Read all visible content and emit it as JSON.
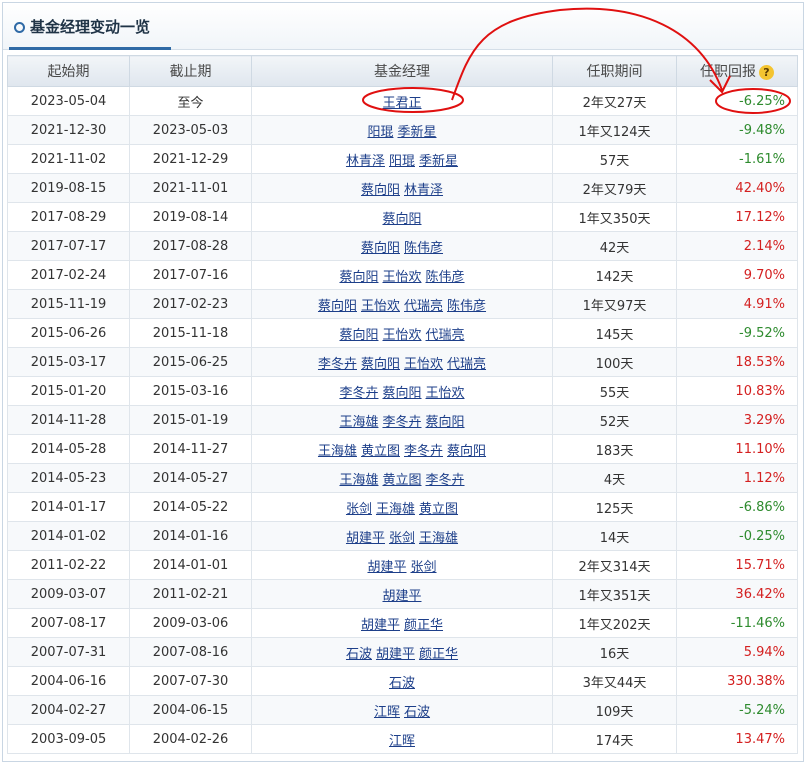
{
  "panel": {
    "title": "基金经理变动一览"
  },
  "table": {
    "headers": {
      "start": "起始期",
      "end": "截止期",
      "managers": "基金经理",
      "period": "任职期间",
      "return": "任职回报",
      "help_icon": "?"
    },
    "rows": [
      {
        "start": "2023-05-04",
        "end": "至今",
        "managers": [
          "王君正"
        ],
        "period": "2年又27天",
        "return": "-6.25%",
        "sign": "neg"
      },
      {
        "start": "2021-12-30",
        "end": "2023-05-03",
        "managers": [
          "阳琨",
          "季新星"
        ],
        "period": "1年又124天",
        "return": "-9.48%",
        "sign": "neg"
      },
      {
        "start": "2021-11-02",
        "end": "2021-12-29",
        "managers": [
          "林青泽",
          "阳琨",
          "季新星"
        ],
        "period": "57天",
        "return": "-1.61%",
        "sign": "neg"
      },
      {
        "start": "2019-08-15",
        "end": "2021-11-01",
        "managers": [
          "蔡向阳",
          "林青泽"
        ],
        "period": "2年又79天",
        "return": "42.40%",
        "sign": "pos"
      },
      {
        "start": "2017-08-29",
        "end": "2019-08-14",
        "managers": [
          "蔡向阳"
        ],
        "period": "1年又350天",
        "return": "17.12%",
        "sign": "pos"
      },
      {
        "start": "2017-07-17",
        "end": "2017-08-28",
        "managers": [
          "蔡向阳",
          "陈伟彦"
        ],
        "period": "42天",
        "return": "2.14%",
        "sign": "pos"
      },
      {
        "start": "2017-02-24",
        "end": "2017-07-16",
        "managers": [
          "蔡向阳",
          "王怡欢",
          "陈伟彦"
        ],
        "period": "142天",
        "return": "9.70%",
        "sign": "pos"
      },
      {
        "start": "2015-11-19",
        "end": "2017-02-23",
        "managers": [
          "蔡向阳",
          "王怡欢",
          "代瑞亮",
          "陈伟彦"
        ],
        "period": "1年又97天",
        "return": "4.91%",
        "sign": "pos"
      },
      {
        "start": "2015-06-26",
        "end": "2015-11-18",
        "managers": [
          "蔡向阳",
          "王怡欢",
          "代瑞亮"
        ],
        "period": "145天",
        "return": "-9.52%",
        "sign": "neg"
      },
      {
        "start": "2015-03-17",
        "end": "2015-06-25",
        "managers": [
          "李冬卉",
          "蔡向阳",
          "王怡欢",
          "代瑞亮"
        ],
        "period": "100天",
        "return": "18.53%",
        "sign": "pos"
      },
      {
        "start": "2015-01-20",
        "end": "2015-03-16",
        "managers": [
          "李冬卉",
          "蔡向阳",
          "王怡欢"
        ],
        "period": "55天",
        "return": "10.83%",
        "sign": "pos"
      },
      {
        "start": "2014-11-28",
        "end": "2015-01-19",
        "managers": [
          "王海雄",
          "李冬卉",
          "蔡向阳"
        ],
        "period": "52天",
        "return": "3.29%",
        "sign": "pos"
      },
      {
        "start": "2014-05-28",
        "end": "2014-11-27",
        "managers": [
          "王海雄",
          "黄立图",
          "李冬卉",
          "蔡向阳"
        ],
        "period": "183天",
        "return": "11.10%",
        "sign": "pos"
      },
      {
        "start": "2014-05-23",
        "end": "2014-05-27",
        "managers": [
          "王海雄",
          "黄立图",
          "李冬卉"
        ],
        "period": "4天",
        "return": "1.12%",
        "sign": "pos"
      },
      {
        "start": "2014-01-17",
        "end": "2014-05-22",
        "managers": [
          "张剑",
          "王海雄",
          "黄立图"
        ],
        "period": "125天",
        "return": "-6.86%",
        "sign": "neg"
      },
      {
        "start": "2014-01-02",
        "end": "2014-01-16",
        "managers": [
          "胡建平",
          "张剑",
          "王海雄"
        ],
        "period": "14天",
        "return": "-0.25%",
        "sign": "neg"
      },
      {
        "start": "2011-02-22",
        "end": "2014-01-01",
        "managers": [
          "胡建平",
          "张剑"
        ],
        "period": "2年又314天",
        "return": "15.71%",
        "sign": "pos"
      },
      {
        "start": "2009-03-07",
        "end": "2011-02-21",
        "managers": [
          "胡建平"
        ],
        "period": "1年又351天",
        "return": "36.42%",
        "sign": "pos"
      },
      {
        "start": "2007-08-17",
        "end": "2009-03-06",
        "managers": [
          "胡建平",
          "颜正华"
        ],
        "period": "1年又202天",
        "return": "-11.46%",
        "sign": "neg"
      },
      {
        "start": "2007-07-31",
        "end": "2007-08-16",
        "managers": [
          "石波",
          "胡建平",
          "颜正华"
        ],
        "period": "16天",
        "return": "5.94%",
        "sign": "pos"
      },
      {
        "start": "2004-06-16",
        "end": "2007-07-30",
        "managers": [
          "石波"
        ],
        "period": "3年又44天",
        "return": "330.38%",
        "sign": "pos"
      },
      {
        "start": "2004-02-27",
        "end": "2004-06-15",
        "managers": [
          "江晖",
          "石波"
        ],
        "period": "109天",
        "return": "-5.24%",
        "sign": "neg"
      },
      {
        "start": "2003-09-05",
        "end": "2004-02-26",
        "managers": [
          "江晖"
        ],
        "period": "174天",
        "return": "13.47%",
        "sign": "pos"
      }
    ]
  },
  "colors": {
    "positive": "#d42020",
    "negative": "#2e8b2e",
    "link": "#1d3f8a",
    "annotation": "#e01010"
  }
}
